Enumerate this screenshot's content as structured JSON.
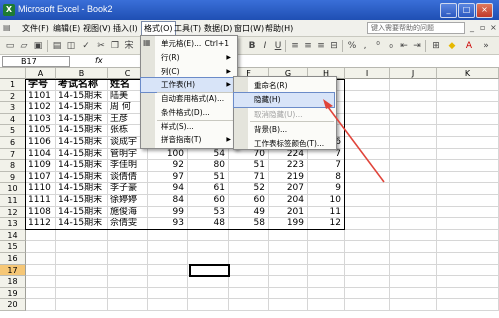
{
  "window": {
    "title": "Microsoft Excel - Book2"
  },
  "menubar": {
    "items": [
      "文件(F)",
      "编辑(E)",
      "视图(V)",
      "插入(I)",
      "格式(O)",
      "工具(T)",
      "数据(D)",
      "窗口(W)",
      "帮助(H)"
    ],
    "help_placeholder": "键入需要帮助的问题"
  },
  "formula": {
    "namebox": "B17",
    "fx": "fx"
  },
  "columns": [
    "A",
    "B",
    "C",
    "D",
    "E",
    "F",
    "G",
    "H",
    "I",
    "J",
    "K"
  ],
  "rows": [
    "1",
    "2",
    "3",
    "4",
    "5",
    "6",
    "7",
    "8",
    "9",
    "10",
    "11",
    "12",
    "13",
    "14",
    "15",
    "16",
    "17",
    "18",
    "19",
    "20"
  ],
  "table": {
    "headers": [
      "学号",
      "考试名称",
      "姓名"
    ],
    "data": [
      [
        "1101",
        "14-15期末",
        "陆美",
        "",
        "",
        "",
        ""
      ],
      [
        "1102",
        "14-15期末",
        "周 何",
        "",
        "",
        "",
        ""
      ],
      [
        "1103",
        "14-15期末",
        "王彦",
        "",
        "",
        "",
        ""
      ],
      [
        "1105",
        "14-15期末",
        "张栋",
        "",
        "",
        "",
        ""
      ],
      [
        "1106",
        "14-15期末",
        "谈成宇",
        "85",
        "92",
        "49",
        "226"
      ],
      [
        "1104",
        "14-15期末",
        "管明宇",
        "100",
        "54",
        "70",
        "224"
      ],
      [
        "1109",
        "14-15期末",
        "李佳明",
        "92",
        "80",
        "51",
        "223"
      ],
      [
        "1107",
        "14-15期末",
        "谈倩倩",
        "97",
        "51",
        "71",
        "219"
      ],
      [
        "1110",
        "14-15期末",
        "李子豪",
        "94",
        "61",
        "52",
        "207"
      ],
      [
        "1111",
        "14-15期末",
        "徐婷婷",
        "84",
        "60",
        "60",
        "204"
      ],
      [
        "1108",
        "14-15期末",
        "施俊海",
        "99",
        "53",
        "49",
        "201"
      ],
      [
        "1112",
        "14-15期末",
        "佘倩雯",
        "93",
        "48",
        "58",
        "199"
      ]
    ],
    "ranks": [
      "",
      "",
      "",
      "",
      "6",
      "7",
      "7",
      "8",
      "9",
      "10",
      "11",
      "12"
    ]
  },
  "format_menu": {
    "items": [
      {
        "label": "单元格(E)...",
        "shortcut": "Ctrl+1",
        "submenu": false
      },
      {
        "label": "行(R)",
        "shortcut": "",
        "submenu": true
      },
      {
        "label": "列(C)",
        "shortcut": "",
        "submenu": true
      },
      {
        "label": "工作表(H)",
        "shortcut": "",
        "submenu": true
      },
      {
        "label": "自动套用格式(A)...",
        "shortcut": "",
        "submenu": false
      },
      {
        "label": "条件格式(D)...",
        "shortcut": "",
        "submenu": false
      },
      {
        "label": "样式(S)...",
        "shortcut": "",
        "submenu": false
      },
      {
        "label": "拼音指南(T)",
        "shortcut": "",
        "submenu": true
      }
    ]
  },
  "sheet_submenu": {
    "items": [
      {
        "label": "重命名(R)",
        "state": "normal"
      },
      {
        "label": "隐藏(H)",
        "state": "highlighted"
      },
      {
        "label": "取消隐藏(U)...",
        "state": "disabled"
      },
      {
        "label": "背景(B)...",
        "state": "normal"
      },
      {
        "label": "工作表标签颜色(T)...",
        "state": "normal"
      }
    ]
  },
  "colors": {
    "title_bar": "#1f4fb3",
    "highlight": "#d8e4f8",
    "selected_row_header": "#f6c776",
    "annotation_arrow": "#e0443a"
  }
}
